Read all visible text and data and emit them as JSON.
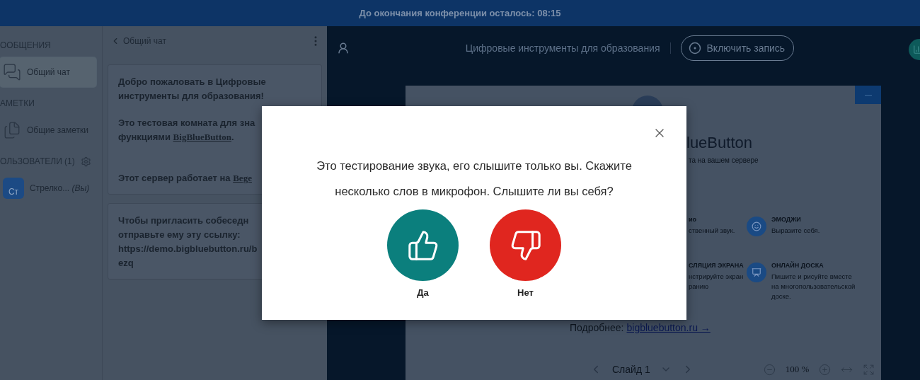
{
  "top_bar": {
    "text": "До окончания конференции осталось: 08:15"
  },
  "sidebar": {
    "sections": [
      {
        "title": "ООБЩЕНИЯ",
        "items": [
          {
            "kind": "chat",
            "label": "Общий чат",
            "selected": true
          }
        ]
      },
      {
        "title": "АМЕТКИ",
        "items": [
          {
            "kind": "notes",
            "label": "Общие заметки",
            "selected": false
          }
        ]
      },
      {
        "title": "ОЛЬЗОВАТЕЛИ (1)",
        "settings": true,
        "items": [
          {
            "kind": "user",
            "initials": "Ст",
            "label": "Стрелко...",
            "suffix": "(Вы)",
            "selected": false
          }
        ]
      }
    ]
  },
  "chat": {
    "title": "Общий чат",
    "messages": [
      {
        "paragraphs": [
          {
            "lines": [
              [
                {
                  "text": "Добро пожаловать в Цифровые"
                }
              ],
              [
                {
                  "text": "инструменты для образования!"
                }
              ]
            ]
          },
          {
            "lines": [
              [
                {
                  "text": "Это тестовая комната для зна"
                }
              ],
              [
                {
                  "text": "функциями "
                },
                {
                  "text": "BigBlueButton",
                  "link": true
                },
                {
                  "text": "."
                }
              ]
            ]
          },
          {
            "lines": [
              [
                {
                  "text": "Этот сервер работает на "
                },
                {
                  "text": "Bege",
                  "link": true
                }
              ]
            ]
          }
        ]
      },
      {
        "paragraphs": [
          {
            "lines": [
              [
                {
                  "text": "Чтобы пригласить собеседн"
                }
              ],
              [
                {
                  "text": "отправьте ему эту ссылку:"
                }
              ],
              [
                {
                  "text": "https://demo.bigbluebutton.ru/b"
                }
              ],
              [
                {
                  "text": "ezq"
                }
              ]
            ]
          }
        ]
      }
    ]
  },
  "presentation": {
    "title": "Цифровые инструменты для образования",
    "record_button": "Включить запись",
    "slide": {
      "heading": "lueButton",
      "subheading": "та на вашем сервере",
      "features": [
        {
          "title": "ио",
          "text": "ственный звук.",
          "icon": false
        },
        {
          "title": "ЭМОДЖИ",
          "text": "Выразите себя.",
          "icon": true
        },
        {
          "title": "СЛЯЦИЯ ЭКРАНА",
          "text": "нстрируйте экран ранию",
          "icon": false
        },
        {
          "title": "ОНЛАЙН ДОСКА",
          "text": "Пишите и рисуйте вместе на многопользовательской доске.",
          "icon": true
        }
      ],
      "more_label": "Подробнее:",
      "more_link": "bigbluebutton.ru →"
    },
    "toolbar": {
      "slide_label": "Слайд 1",
      "zoom": "100 %"
    }
  },
  "dialog": {
    "message": "Это тестирование звука, его слышите только вы. Скажите несколько слов в микрофон. Слышите ли вы себя?",
    "answers": [
      {
        "kind": "yes",
        "label": "Да"
      },
      {
        "kind": "no",
        "label": "Нет"
      }
    ]
  }
}
